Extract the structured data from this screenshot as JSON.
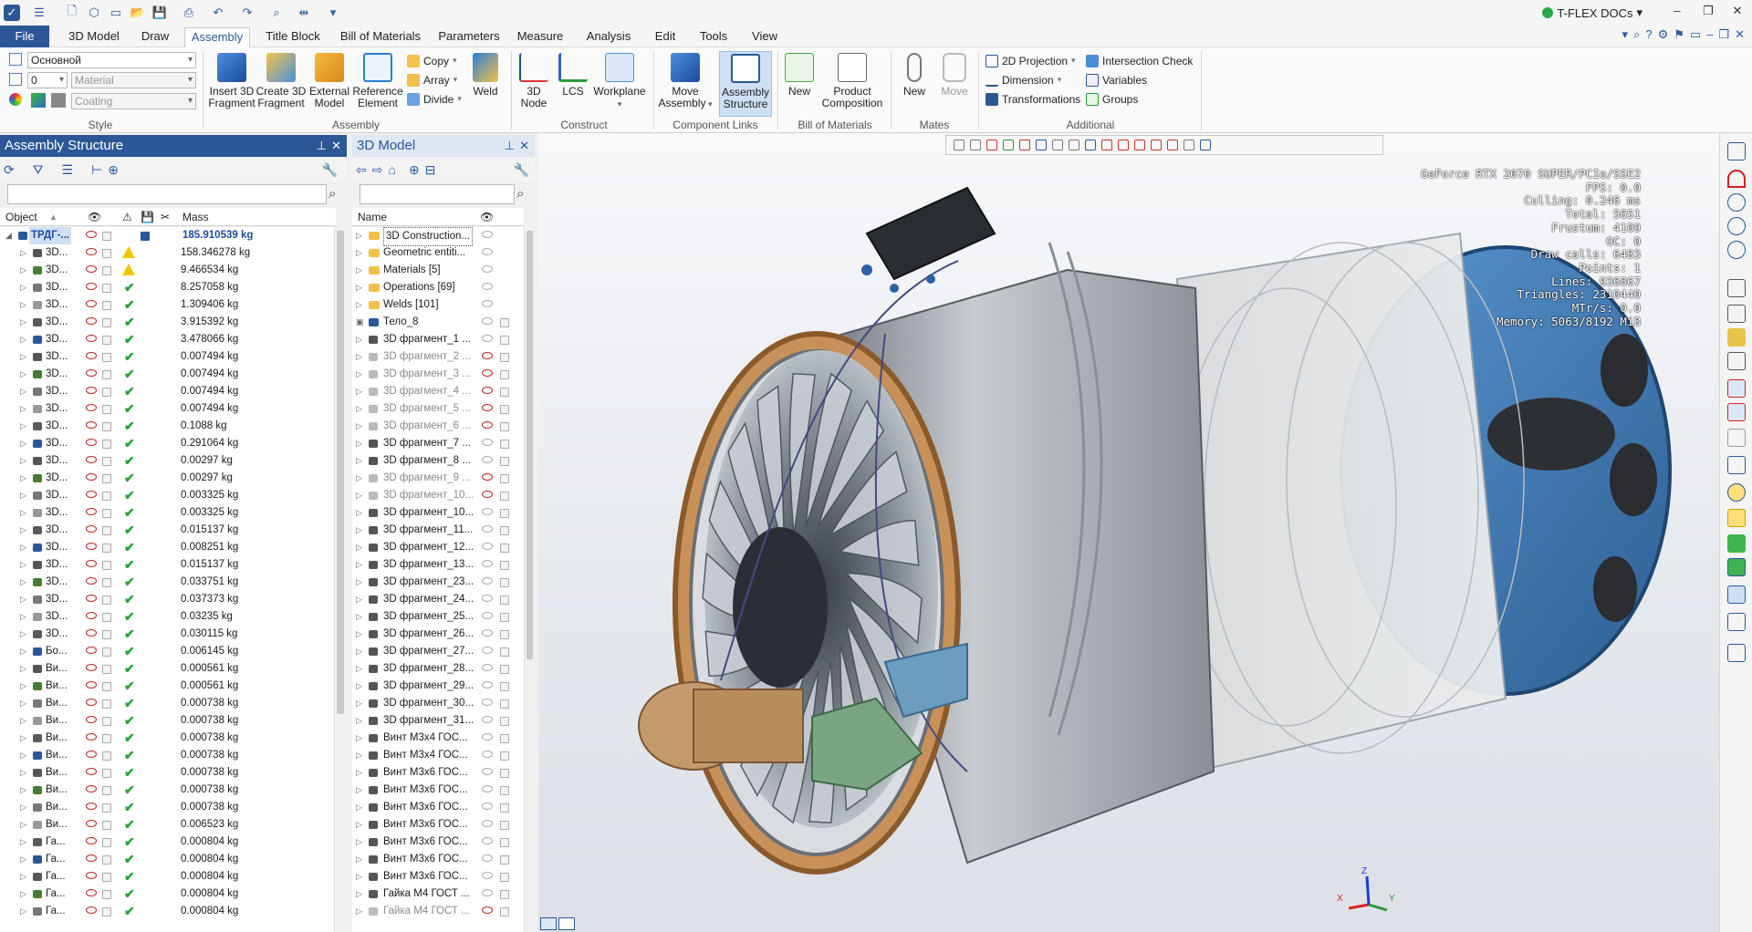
{
  "app": {
    "brand": "T-FLEX DOCs",
    "quick_access_icons": [
      "app-logo-icon",
      "menu-icon",
      "new-file-icon",
      "3d-box-icon",
      "window-icon",
      "open-folder-icon",
      "save-icon",
      "print-icon",
      "undo-icon",
      "redo-icon",
      "zoom-icon",
      "measure-icon",
      "more-icon"
    ]
  },
  "tabs": [
    "File",
    "3D Model",
    "Draw",
    "Assembly",
    "Title Block",
    "Bill of Materials",
    "Parameters",
    "Measure",
    "Analysis",
    "Edit",
    "Tools",
    "View"
  ],
  "active_tab": "Assembly",
  "ribbon": {
    "style": {
      "layer": "Основной",
      "level": "0",
      "material_placeholder": "Material",
      "coating_placeholder": "Coating",
      "group": "Style"
    },
    "assembly": {
      "insert": "Insert 3D Fragment",
      "create": "Create 3D Fragment",
      "external": "External Model",
      "reference": "Reference Element",
      "copy": "Copy",
      "array": "Array",
      "divide": "Divide",
      "weld": "Weld",
      "group": "Assembly"
    },
    "construct": {
      "node": "3D Node",
      "lcs": "LCS",
      "workplane": "Workplane",
      "group": "Construct"
    },
    "links": {
      "move": "Move Assembly",
      "structure": "Assembly Structure",
      "group": "Component Links"
    },
    "bom": {
      "new": "New",
      "composition": "Product Composition",
      "group": "Bill of Materials"
    },
    "mates": {
      "new": "New",
      "move": "Move",
      "group": "Mates"
    },
    "additional": {
      "projection": "2D Projection",
      "dimension": "Dimension",
      "transformations": "Transformations",
      "intersection": "Intersection Check",
      "variables": "Variables",
      "groups": "Groups",
      "group": "Additional"
    }
  },
  "assembly_panel": {
    "title": "Assembly Structure",
    "col_object": "Object",
    "col_mass": "Mass",
    "rows": [
      {
        "name": "ТРДГ-...",
        "mass": "185.910539 kg",
        "status": "root"
      },
      {
        "name": "3D...",
        "mass": "158.346278 kg",
        "status": "warn"
      },
      {
        "name": "3D...",
        "mass": "9.466534 kg",
        "status": "warn"
      },
      {
        "name": "3D...",
        "mass": "8.257058 kg",
        "status": "ok"
      },
      {
        "name": "3D...",
        "mass": "1.309406 kg",
        "status": "ok"
      },
      {
        "name": "3D...",
        "mass": "3.915392 kg",
        "status": "ok"
      },
      {
        "name": "3D...",
        "mass": "3.478066 kg",
        "status": "ok"
      },
      {
        "name": "3D...",
        "mass": "0.007494 kg",
        "status": "ok"
      },
      {
        "name": "3D...",
        "mass": "0.007494 kg",
        "status": "ok"
      },
      {
        "name": "3D...",
        "mass": "0.007494 kg",
        "status": "ok"
      },
      {
        "name": "3D...",
        "mass": "0.007494 kg",
        "status": "ok"
      },
      {
        "name": "3D...",
        "mass": "0.1088 kg",
        "status": "ok"
      },
      {
        "name": "3D...",
        "mass": "0.291064 kg",
        "status": "ok"
      },
      {
        "name": "3D...",
        "mass": "0.00297 kg",
        "status": "ok"
      },
      {
        "name": "3D...",
        "mass": "0.00297 kg",
        "status": "ok"
      },
      {
        "name": "3D...",
        "mass": "0.003325 kg",
        "status": "ok"
      },
      {
        "name": "3D...",
        "mass": "0.003325 kg",
        "status": "ok"
      },
      {
        "name": "3D...",
        "mass": "0.015137 kg",
        "status": "ok"
      },
      {
        "name": "3D...",
        "mass": "0.008251 kg",
        "status": "ok"
      },
      {
        "name": "3D...",
        "mass": "0.015137 kg",
        "status": "ok"
      },
      {
        "name": "3D...",
        "mass": "0.033751 kg",
        "status": "ok"
      },
      {
        "name": "3D...",
        "mass": "0.037373 kg",
        "status": "ok"
      },
      {
        "name": "3D...",
        "mass": "0.03235 kg",
        "status": "ok"
      },
      {
        "name": "3D...",
        "mass": "0.030115 kg",
        "status": "ok"
      },
      {
        "name": "Бо...",
        "mass": "0.006145 kg",
        "status": "ok"
      },
      {
        "name": "Ви...",
        "mass": "0.000561 kg",
        "status": "ok"
      },
      {
        "name": "Ви...",
        "mass": "0.000561 kg",
        "status": "ok"
      },
      {
        "name": "Ви...",
        "mass": "0.000738 kg",
        "status": "ok"
      },
      {
        "name": "Ви...",
        "mass": "0.000738 kg",
        "status": "ok"
      },
      {
        "name": "Ви...",
        "mass": "0.000738 kg",
        "status": "ok"
      },
      {
        "name": "Ви...",
        "mass": "0.000738 kg",
        "status": "ok"
      },
      {
        "name": "Ви...",
        "mass": "0.000738 kg",
        "status": "ok"
      },
      {
        "name": "Ви...",
        "mass": "0.000738 kg",
        "status": "ok"
      },
      {
        "name": "Ви...",
        "mass": "0.000738 kg",
        "status": "ok"
      },
      {
        "name": "Ви...",
        "mass": "0.006523 kg",
        "status": "ok"
      },
      {
        "name": "Га...",
        "mass": "0.000804 kg",
        "status": "ok"
      },
      {
        "name": "Га...",
        "mass": "0.000804 kg",
        "status": "ok"
      },
      {
        "name": "Га...",
        "mass": "0.000804 kg",
        "status": "ok"
      },
      {
        "name": "Га...",
        "mass": "0.000804 kg",
        "status": "ok"
      },
      {
        "name": "Га...",
        "mass": "0.000804 kg",
        "status": "ok"
      }
    ]
  },
  "model_panel": {
    "title": "3D Model",
    "col_name": "Name",
    "rows": [
      {
        "name": "3D Construction...",
        "kind": "folder"
      },
      {
        "name": "Geometric entiti...",
        "kind": "folder"
      },
      {
        "name": "Materials [5]",
        "kind": "folder"
      },
      {
        "name": "Operations [69]",
        "kind": "folder"
      },
      {
        "name": "Welds [101]",
        "kind": "folder"
      },
      {
        "name": "Тело_8",
        "kind": "body"
      },
      {
        "name": "3D фрагмент_1 ...",
        "kind": "frag"
      },
      {
        "name": "3D фрагмент_2 ...",
        "kind": "frag-off"
      },
      {
        "name": "3D фрагмент_3 ...",
        "kind": "frag-off"
      },
      {
        "name": "3D фрагмент_4 ...",
        "kind": "frag-off"
      },
      {
        "name": "3D фрагмент_5 ...",
        "kind": "frag-off"
      },
      {
        "name": "3D фрагмент_6 ...",
        "kind": "frag-off"
      },
      {
        "name": "3D фрагмент_7 ...",
        "kind": "frag"
      },
      {
        "name": "3D фрагмент_8 ...",
        "kind": "frag"
      },
      {
        "name": "3D фрагмент_9 ...",
        "kind": "frag-off"
      },
      {
        "name": "3D фрагмент_10...",
        "kind": "frag-off"
      },
      {
        "name": "3D фрагмент_10...",
        "kind": "frag"
      },
      {
        "name": "3D фрагмент_11...",
        "kind": "frag"
      },
      {
        "name": "3D фрагмент_12...",
        "kind": "frag"
      },
      {
        "name": "3D фрагмент_13...",
        "kind": "frag"
      },
      {
        "name": "3D фрагмент_23...",
        "kind": "frag"
      },
      {
        "name": "3D фрагмент_24...",
        "kind": "frag"
      },
      {
        "name": "3D фрагмент_25...",
        "kind": "frag"
      },
      {
        "name": "3D фрагмент_26...",
        "kind": "frag"
      },
      {
        "name": "3D фрагмент_27...",
        "kind": "frag"
      },
      {
        "name": "3D фрагмент_28...",
        "kind": "frag"
      },
      {
        "name": "3D фрагмент_29...",
        "kind": "frag"
      },
      {
        "name": "3D фрагмент_30...",
        "kind": "frag"
      },
      {
        "name": "3D фрагмент_31...",
        "kind": "frag"
      },
      {
        "name": "Винт М3х4 ГОС...",
        "kind": "frag"
      },
      {
        "name": "Винт М3х4 ГОС...",
        "kind": "frag"
      },
      {
        "name": "Винт М3х6 ГОС...",
        "kind": "frag"
      },
      {
        "name": "Винт М3х6 ГОС...",
        "kind": "frag"
      },
      {
        "name": "Винт М3х6 ГОС...",
        "kind": "frag"
      },
      {
        "name": "Винт М3х6 ГОС...",
        "kind": "frag"
      },
      {
        "name": "Винт М3х6 ГОС...",
        "kind": "frag"
      },
      {
        "name": "Винт М3х6 ГОС...",
        "kind": "frag"
      },
      {
        "name": "Винт М3х6 ГОС...",
        "kind": "frag"
      },
      {
        "name": "Гайка М4 ГОСТ ...",
        "kind": "frag"
      },
      {
        "name": "Гайка М4 ГОСТ ...",
        "kind": "frag-off"
      }
    ]
  },
  "viewport": {
    "stats": [
      "GeForce RTX 2070 SUPER/PCIe/SSE2",
      "FPS: 0.0",
      "Culling: 0.246 ms",
      "Total: 5651",
      "Frustum: 4109",
      "OC: 0",
      "Draw calls: 6483",
      "Points: 1",
      "Lines: 936867",
      "Triangles: 2310440",
      "MTr/s: 0.0",
      "Memory: 5063/8192 MiB"
    ],
    "axes": {
      "x": "X",
      "y": "Y",
      "z": "Z"
    },
    "colors": {
      "casing_blue": "#3d7ab8",
      "flange_bronze": "#c8915a",
      "gearbox_green": "#7aa583",
      "steel": "#8a9096"
    }
  }
}
